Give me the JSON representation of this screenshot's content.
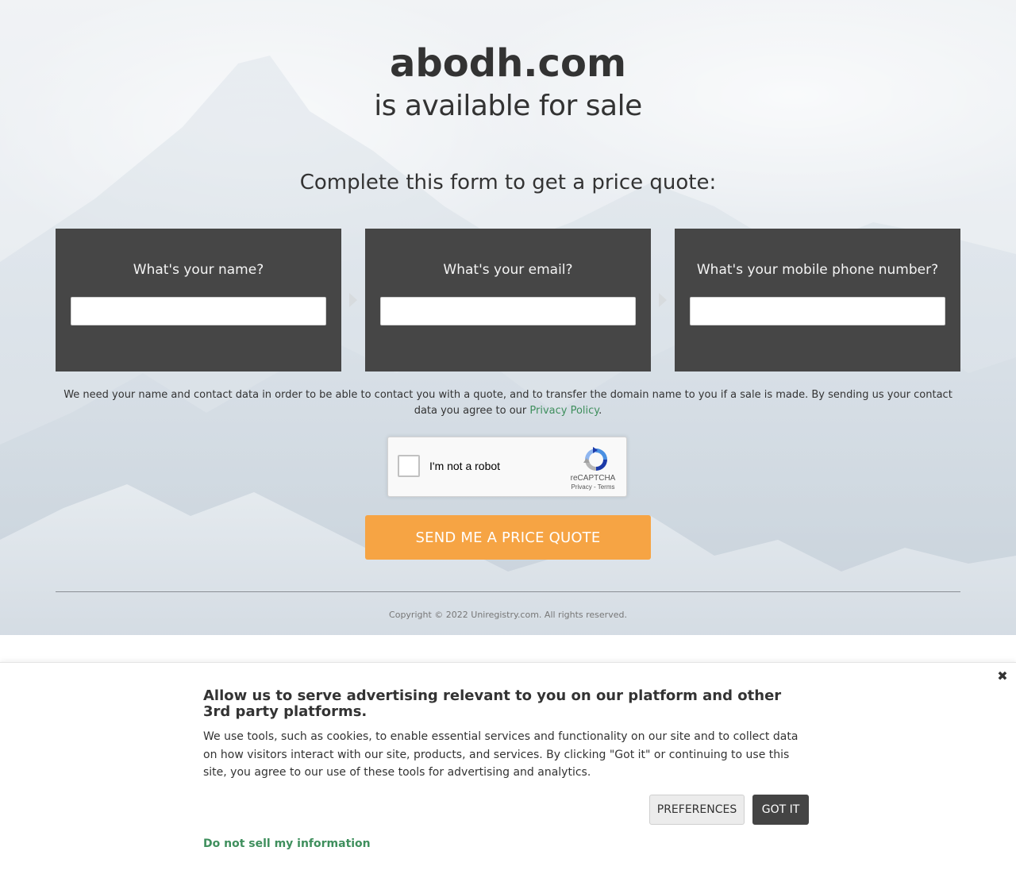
{
  "hero": {
    "domain": "abodh.com",
    "subtitle": "is available for sale",
    "form_heading": "Complete this form to get a price quote:"
  },
  "form": {
    "name_label": "What's your name?",
    "email_label": "What's your email?",
    "phone_label": "What's your mobile phone number?",
    "name_value": "",
    "email_value": "",
    "phone_value": ""
  },
  "consent": {
    "text": "We need your name and contact data in order to be able to contact you with a quote, and to transfer the domain name to you if a sale is made. By sending us your contact data you agree to our ",
    "privacy_link": "Privacy Policy",
    "end": "."
  },
  "captcha": {
    "label": "I'm not a robot",
    "brand": "reCAPTCHA",
    "privacy": "Privacy",
    "separator": " - ",
    "terms": "Terms"
  },
  "quote_button": "SEND ME A PRICE QUOTE",
  "footer": {
    "copyright": "Copyright © 2022 Uniregistry.com. All rights reserved."
  },
  "banner": {
    "title": "Allow us to serve advertising relevant to you on our platform and other 3rd party platforms.",
    "body": "We use tools, such as cookies, to enable essential services and functionality on our site and to collect data on how visitors interact with our site, products, and services. By clicking \"Got it\" or continuing to use this site, you agree to our use of these tools for advertising and analytics.",
    "preferences_label": "PREFERENCES",
    "got_it_label": "GOT IT",
    "do_not_sell": "Do not sell my information",
    "close_icon": "close-icon"
  },
  "colors": {
    "card_bg": "#464646",
    "button_orange": "#f6a444",
    "link_green": "#3f8f5d",
    "got_it_bg": "#444444"
  }
}
